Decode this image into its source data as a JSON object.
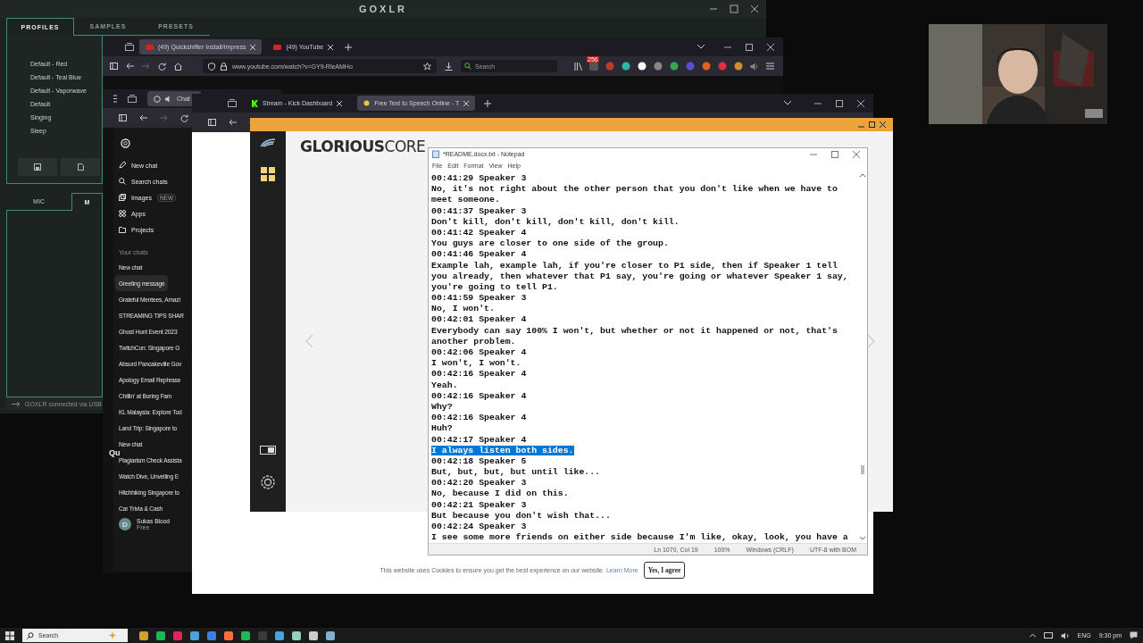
{
  "goxlr": {
    "logo": "GOXLR",
    "tabs": [
      {
        "label": "PROFILES",
        "selected": true
      },
      {
        "label": "SAMPLES",
        "selected": false
      },
      {
        "label": "PRESETS",
        "selected": false
      }
    ],
    "profiles": [
      "Default - Red",
      "Default - Teal Blue",
      "Default - Vaporwave",
      "Default",
      "Singing",
      "Sleep"
    ],
    "bottom_tabs": [
      {
        "label": "MIC",
        "selected": false
      },
      {
        "label": "M",
        "selected": true
      }
    ],
    "status": "GOXLR connected via USB"
  },
  "browser_back": {
    "tabs": [
      {
        "label": "(49) Quickshifter Install/Impress",
        "selected": true
      },
      {
        "label": "(49) YouTube",
        "selected": false
      }
    ],
    "url": "www.youtube.com/watch?v=GY9-RleAMHo",
    "search": {
      "placeholder": "Search"
    },
    "badge": "256"
  },
  "chat_window": {
    "tab": "Chat",
    "nav": [
      {
        "label": "New chat",
        "kind": "new"
      },
      {
        "label": "Search chats",
        "kind": "search"
      },
      {
        "label": "Images",
        "kind": "images",
        "badge": "NEW"
      },
      {
        "label": "Apps",
        "kind": "apps"
      },
      {
        "label": "Projects",
        "kind": "projects"
      }
    ],
    "section": "Your chats",
    "chats": [
      {
        "label": "New chat",
        "selected": false
      },
      {
        "label": "Greeting message",
        "selected": true
      },
      {
        "label": "Grateful Mentees, Amazi",
        "selected": false
      },
      {
        "label": "STREAMING TIPS SHAR",
        "selected": false
      },
      {
        "label": "Ghost Hunt Event 2023",
        "selected": false
      },
      {
        "label": "TwitchCon: Singapore G",
        "selected": false
      },
      {
        "label": "Absurd Pancakeville Gov",
        "selected": false
      },
      {
        "label": "Apology Email Rephrase",
        "selected": false
      },
      {
        "label": "Chillin' at Boring Fam",
        "selected": false
      },
      {
        "label": "KL Malaysia: Explore Tod",
        "selected": false
      },
      {
        "label": "Land Trip: Singapore to",
        "selected": false
      },
      {
        "label": "New chat",
        "selected": false
      },
      {
        "label": "Plagiarism Check Assista",
        "selected": false
      },
      {
        "label": "Watch Dive, Unveiling E",
        "selected": false
      },
      {
        "label": "Hitchhiking Singapore to",
        "selected": false
      },
      {
        "label": "Car Trivia & Cash",
        "selected": false
      }
    ],
    "heading": "Qu",
    "user": {
      "initial": "D",
      "name": "Sukas Blood",
      "plan": "Free"
    }
  },
  "browser_front": {
    "tabs": [
      {
        "label": "Stream - Kick Dashboard",
        "selected": false
      },
      {
        "label": "Free Text to Speech Online - T",
        "selected": true
      }
    ],
    "cookie": {
      "text": "This website uses Cookies to ensure you get the best experience on our website.",
      "link": "Learn More",
      "button": "Yes, I agree"
    }
  },
  "glorious": {
    "logo": "**GLORIOUS**CORE"
  },
  "notepad": {
    "title": "*README.docx.txt - Notepad",
    "menu": [
      "File",
      "Edit",
      "Format",
      "View",
      "Help"
    ],
    "lines": [
      {
        "text": "00:41:29 Speaker 3",
        "selected": false
      },
      {
        "text": "No, it's not right about the other person that you don't like when we have to",
        "selected": false
      },
      {
        "text": "meet someone.",
        "selected": false
      },
      {
        "text": "00:41:37 Speaker 3",
        "selected": false
      },
      {
        "text": "Don't kill, don't kill, don't kill, don't kill.",
        "selected": false
      },
      {
        "text": "00:41:42 Speaker 4",
        "selected": false
      },
      {
        "text": "You guys are closer to one side of the group.",
        "selected": false
      },
      {
        "text": "00:41:46 Speaker 4",
        "selected": false
      },
      {
        "text": "Example lah, example lah, if you're closer to P1 side, then if Speaker 1 tell",
        "selected": false
      },
      {
        "text": "you already, then whatever that P1 say, you're going or whatever Speaker 1 say,",
        "selected": false
      },
      {
        "text": "you're going to tell P1.",
        "selected": false
      },
      {
        "text": "00:41:59 Speaker 3",
        "selected": false
      },
      {
        "text": "No, I won't.",
        "selected": false
      },
      {
        "text": "00:42:01 Speaker 4",
        "selected": false
      },
      {
        "text": "Everybody can say 100% I won't, but whether or not it happened or not, that's",
        "selected": false
      },
      {
        "text": "another problem.",
        "selected": false
      },
      {
        "text": "00:42:06 Speaker 4",
        "selected": false
      },
      {
        "text": "I won't, I won't.",
        "selected": false
      },
      {
        "text": "00:42:16 Speaker 4",
        "selected": false
      },
      {
        "text": "Yeah.",
        "selected": false
      },
      {
        "text": "00:42:16 Speaker 4",
        "selected": false
      },
      {
        "text": "Why?",
        "selected": false
      },
      {
        "text": "00:42:16 Speaker 4",
        "selected": false
      },
      {
        "text": "Huh?",
        "selected": false
      },
      {
        "text": "00:42:17 Speaker 4",
        "selected": false
      },
      {
        "text": "I always listen both sides.",
        "selected": true
      },
      {
        "text": "00:42:18 Speaker 5",
        "selected": false
      },
      {
        "text": "But, but, but, but until like...",
        "selected": false
      },
      {
        "text": "00:42:20 Speaker 3",
        "selected": false
      },
      {
        "text": "No, because I did on this.",
        "selected": false
      },
      {
        "text": "00:42:21 Speaker 3",
        "selected": false
      },
      {
        "text": "But because you don't wish that...",
        "selected": false
      },
      {
        "text": "00:42:24 Speaker 3",
        "selected": false
      },
      {
        "text": "I see some more friends on either side because I'm like, okay, look, you have a",
        "selected": false
      }
    ],
    "status": [
      "Ln 1070, Col 19",
      "100%",
      "Windows (CRLF)",
      "UTF-8 with BOM"
    ]
  },
  "taskbar": {
    "search": {
      "placeholder": "Search"
    },
    "language": "ENG",
    "time": "9:30 pm"
  }
}
